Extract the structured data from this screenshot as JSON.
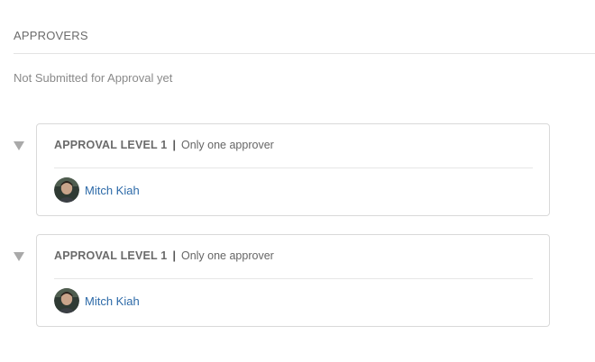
{
  "section": {
    "title": "APPROVERS",
    "status": "Not Submitted for Approval yet"
  },
  "levels": [
    {
      "label": "APPROVAL LEVEL 1",
      "separator": "|",
      "rule": "Only one approver",
      "approver": {
        "name": "Mitch Kiah",
        "avatar_icon": "user-avatar-photo"
      }
    },
    {
      "label": "APPROVAL LEVEL 1",
      "separator": "|",
      "rule": "Only one approver",
      "approver": {
        "name": "Mitch Kiah",
        "avatar_icon": "user-avatar-photo"
      }
    }
  ],
  "colors": {
    "link": "#2d6aa8",
    "muted_text": "#8a8a8a",
    "border": "#d9d9d9",
    "caret": "#a9a9a9"
  }
}
